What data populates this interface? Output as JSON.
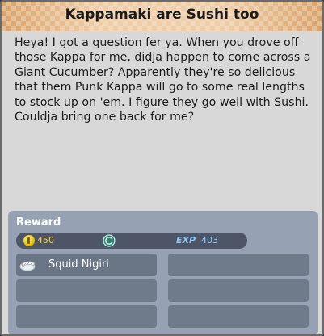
{
  "quest": {
    "title": "Kappamaki are Sushi too",
    "description": "Heya! I got a question fer ya. When you drove off those Kappa for me, didja happen to come across a Giant Cucumber? Apparently they're so delicious that them Punk Kappa will go to some real lengths to stock up on 'em. I figure they go well with Sushi. Couldja bring one back for me?"
  },
  "reward": {
    "label": "Reward",
    "money": "450",
    "exp_label": "EXP",
    "exp": "403",
    "items": [
      {
        "name": "Squid Nigiri",
        "icon": "squid-nigiri-icon"
      },
      {
        "name": ""
      },
      {
        "name": ""
      },
      {
        "name": ""
      },
      {
        "name": ""
      },
      {
        "name": ""
      }
    ]
  },
  "colors": {
    "title_bg": "#d9a36a",
    "panel_bg": "#d8d8d8",
    "reward_bg": "#96a2b3",
    "currency_bar": "#4d5566",
    "money_text": "#f1d04a",
    "exp_text": "#8ec8f0"
  }
}
